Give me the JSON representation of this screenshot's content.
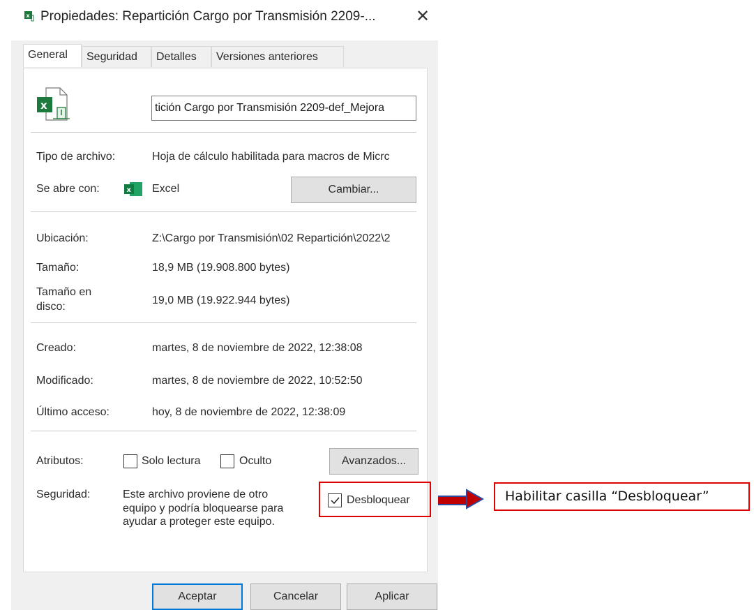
{
  "window": {
    "title": "Propiedades: Repartición Cargo por Transmisión 2209-...",
    "close_glyph": "✕"
  },
  "tabs": [
    {
      "label": "General",
      "active": true
    },
    {
      "label": "Seguridad",
      "active": false
    },
    {
      "label": "Detalles",
      "active": false
    },
    {
      "label": "Versiones anteriores",
      "active": false
    }
  ],
  "file": {
    "icon": "excel-file-icon",
    "name_value": "tición Cargo por Transmisión 2209-def_Mejora"
  },
  "type_row": {
    "label": "Tipo de archivo:",
    "value": "Hoja de cálculo habilitada para macros de Micrc"
  },
  "opens_row": {
    "label": "Se abre con:",
    "app": "Excel",
    "change_button": "Cambiar..."
  },
  "location_row": {
    "label": "Ubicación:",
    "value": "Z:\\Cargo por Transmisión\\02 Repartición\\2022\\2"
  },
  "size_row": {
    "label": "Tamaño:",
    "value": "18,9 MB (19.908.800 bytes)"
  },
  "disk_size_row": {
    "label_line1": "Tamaño en",
    "label_line2": "disco:",
    "value": "19,0 MB (19.922.944 bytes)"
  },
  "created_row": {
    "label": "Creado:",
    "value": "martes, 8 de noviembre de 2022, 12:38:08"
  },
  "modified_row": {
    "label": "Modificado:",
    "value": "martes, 8 de noviembre de 2022, 10:52:50"
  },
  "accessed_row": {
    "label": "Último acceso:",
    "value": "hoy, 8 de noviembre de 2022, 12:38:09"
  },
  "attributes": {
    "label": "Atributos:",
    "readonly_label": "Solo lectura",
    "readonly_checked": false,
    "hidden_label": "Oculto",
    "hidden_checked": false,
    "advanced_button": "Avanzados..."
  },
  "security": {
    "label": "Seguridad:",
    "line1": "Este archivo proviene de otro",
    "line2": "equipo y podría bloquearse para",
    "line3": "ayudar a proteger este equipo.",
    "unblock_label": "Desbloquear",
    "unblock_checked": true
  },
  "footer": {
    "ok": "Aceptar",
    "cancel": "Cancelar",
    "apply": "Aplicar"
  },
  "annotation": {
    "text": "Habilitar casilla “Desbloquear”"
  },
  "colors": {
    "annotation_red": "#e00000",
    "arrow_red": "#c00000",
    "arrow_blue": "#2e4a9e",
    "excel_green": "#1d7a3c"
  }
}
